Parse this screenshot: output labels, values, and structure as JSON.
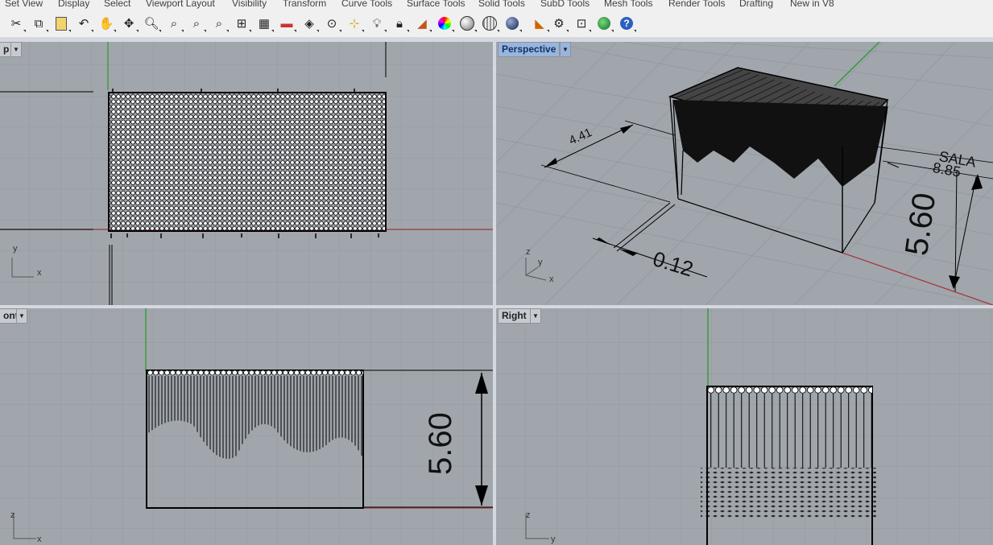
{
  "menu": [
    "Set View",
    "Display",
    "Select",
    "Viewport Layout",
    "Visibility",
    "Transform",
    "Curve Tools",
    "Surface Tools",
    "Solid Tools",
    "SubD Tools",
    "Mesh Tools",
    "Render Tools",
    "Drafting",
    "New in V8"
  ],
  "toolbar_icons": [
    "cut-icon",
    "copy-icon",
    "paste-icon",
    "undo-icon",
    "pan-hand-icon",
    "rotate-view-icon",
    "zoom-icon",
    "zoom-window-icon",
    "zoom-extents-icon",
    "zoom-selected-icon",
    "four-viewports-icon",
    "car-icon",
    "grid-icon",
    "snap-icon",
    "osnap-icon",
    "light-icon",
    "lock-icon",
    "layer-icon",
    "color-wheel-icon",
    "shaded-sphere-icon",
    "mesh-sphere-icon",
    "render-sphere-icon",
    "gumball-icon",
    "options-gear-icon",
    "dimension-icon",
    "globe-icon",
    "help-icon"
  ],
  "viewports": {
    "top": {
      "label": "p",
      "axis_a": "y",
      "axis_b": "x"
    },
    "perspective": {
      "label": "Perspective",
      "axis_a": "z",
      "axis_b": "y",
      "axis_c": "x",
      "dim_a": "4.41",
      "dim_b": "0.12",
      "dim_c": "5.60",
      "dim_d": "8.85",
      "dim_e": "SALA"
    },
    "front": {
      "label": "ont",
      "axis_a": "z",
      "axis_b": "x",
      "dim_a": "5.60"
    },
    "right": {
      "label": "Right",
      "axis_a": "z",
      "axis_b": "y"
    }
  },
  "colors": {
    "viewport_bg": "#a1a6ad",
    "grid_line": "#94999f",
    "axis_red": "#a63a3a",
    "axis_green": "#2a9a2a",
    "active_label": "#98b5e0"
  }
}
